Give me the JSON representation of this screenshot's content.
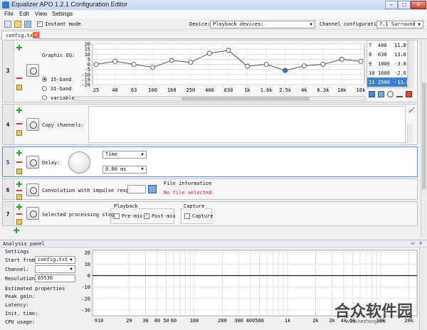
{
  "window": {
    "title": "Equalizer APO 1.2.1 Configuration Editor"
  },
  "menu": [
    "File",
    "Edit",
    "View",
    "Settings"
  ],
  "toolbar": {
    "instant_mode_label": "Instant mode",
    "device_label": "Device:",
    "device_value": "Playback devices:",
    "channel_config_label": "Channel configuration:",
    "channel_config_value": "7.1 Surround"
  },
  "tab": {
    "label": "config.txt"
  },
  "filters": {
    "graphic_eq": {
      "number": "3",
      "label": "Graphic EQ:",
      "options": [
        "15-band",
        "31-band",
        "variable"
      ],
      "selected": "15-band",
      "y_ticks": [
        "20",
        "15",
        "10",
        "5",
        "0",
        "-5",
        "-10",
        "-15",
        "-20"
      ],
      "x_labels": [
        "25",
        "40",
        "63",
        "100",
        "160",
        "250",
        "400",
        "630",
        "1k",
        "1.6k",
        "2.5k",
        "4k",
        "6.3k",
        "10k",
        "16k"
      ],
      "gains": [
        0,
        3,
        0,
        -3,
        3.8,
        2,
        11,
        13.8,
        -1.8,
        0,
        -6,
        -1.5,
        0,
        5,
        3
      ],
      "table": [
        [
          "7",
          "400",
          "11.8"
        ],
        [
          "8",
          "630",
          "13.8"
        ],
        [
          "9",
          "1000",
          "-3.8"
        ],
        [
          "10",
          "1600",
          "-2.6"
        ],
        [
          "11",
          "2500",
          "-13.8"
        ]
      ]
    },
    "copy": {
      "number": "4",
      "label": "Copy channels:"
    },
    "delay": {
      "number": "5",
      "label": "Delay:",
      "unit": "Time",
      "value": "0.00 ms"
    },
    "convolution": {
      "number": "6",
      "label": "Convolution with impulse response:",
      "file_info_title": "File information",
      "no_file": "No file selected"
    },
    "stage": {
      "number": "7",
      "label": "Selected processing stage:",
      "playback_title": "Playback",
      "premix": "Pre-mix",
      "postmix": "Post-mix",
      "capture_title": "Capture",
      "capture": "Capture"
    }
  },
  "analysis": {
    "title": "Analysis panel",
    "settings_title": "Settings",
    "start_from_label": "Start from:",
    "start_from_value": "config.txt",
    "channel_label": "Channel:",
    "resolution_label": "Resolution:",
    "resolution_value": "65536",
    "estimated_title": "Estimated properties",
    "peak_gain": "Peak gain:",
    "latency": "Latency:",
    "init_time": "Init. time:",
    "cpu_usage": "CPU usage:",
    "y_ticks": [
      "20",
      "10",
      "0",
      "-10",
      "-20",
      "-30"
    ],
    "x_labels": [
      "910",
      "20",
      "30",
      "40",
      "50",
      "60",
      "100",
      "200",
      "300",
      "400",
      "500",
      "1k",
      "2k",
      "3k",
      "4k",
      "5k",
      "10k",
      "20k"
    ]
  },
  "watermark": {
    "line1": "合众软件园",
    "line2": "www.hezhong.net"
  }
}
